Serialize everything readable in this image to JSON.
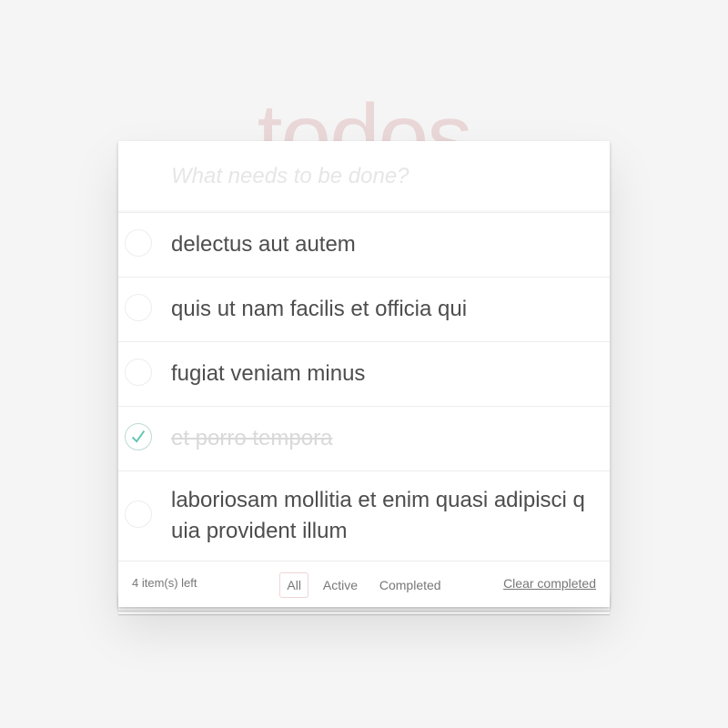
{
  "app": {
    "title": "todos"
  },
  "new_todo": {
    "placeholder": "What needs to be done?",
    "value": ""
  },
  "todos": [
    {
      "label": "delectus aut autem",
      "completed": false
    },
    {
      "label": "quis ut nam facilis et officia qui",
      "completed": false
    },
    {
      "label": "fugiat veniam minus",
      "completed": false
    },
    {
      "label": "et porro tempora",
      "completed": true
    },
    {
      "label": "laboriosam mollitia et enim quasi adipisci quia provident illum",
      "completed": false
    }
  ],
  "footer": {
    "count_text": "4 item(s) left",
    "filters": [
      {
        "label": "All",
        "selected": true
      },
      {
        "label": "Active",
        "selected": false
      },
      {
        "label": "Completed",
        "selected": false
      }
    ],
    "clear_label": "Clear completed"
  },
  "colors": {
    "title": "#af2f2f",
    "check": "#5dc2af",
    "background": "#f5f5f5"
  },
  "icons": {
    "toggle_checked": "check-icon"
  }
}
